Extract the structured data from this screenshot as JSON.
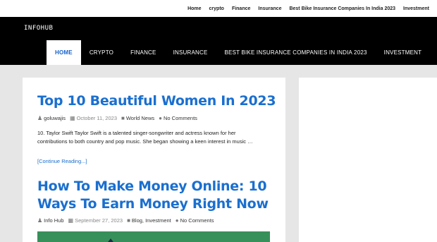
{
  "topnav": [
    "Home",
    "crypto",
    "Finance",
    "Insurance",
    "Best Bike Insurance Companies In India 2023",
    "Investment"
  ],
  "site": {
    "logo": "INFOHUB"
  },
  "mainnav": [
    "HOME",
    "CRYPTO",
    "FINANCE",
    "INSURANCE",
    "BEST BIKE INSURANCE COMPANIES IN INDIA 2023",
    "INVESTMENT"
  ],
  "posts": [
    {
      "title": "Top 10 Beautiful Women In 2023",
      "author": "goluwajis",
      "date": "October 11, 2023",
      "category": "World News",
      "comments": "No Comments",
      "excerpt": "10. Taylor Swift Taylor Swift is a talented singer-songwriter and actress known for her contributions to both country and pop music. She began showing a keen interest in music …",
      "readmore": "[Continue Reading...]"
    },
    {
      "title": "How To Make Money Online: 10 Ways To Earn Money Right Now",
      "author": "Info Hub",
      "date": "September 27, 2023",
      "category": "Blog, Investment",
      "comments": "No Comments"
    }
  ],
  "icons": {
    "author": "user-icon",
    "date": "calendar-icon",
    "category": "folder-icon",
    "comments": "comment-icon"
  },
  "colors": {
    "accent": "#1a6fcf",
    "header_bg": "#000000",
    "page_bg": "#e6e6e6"
  }
}
